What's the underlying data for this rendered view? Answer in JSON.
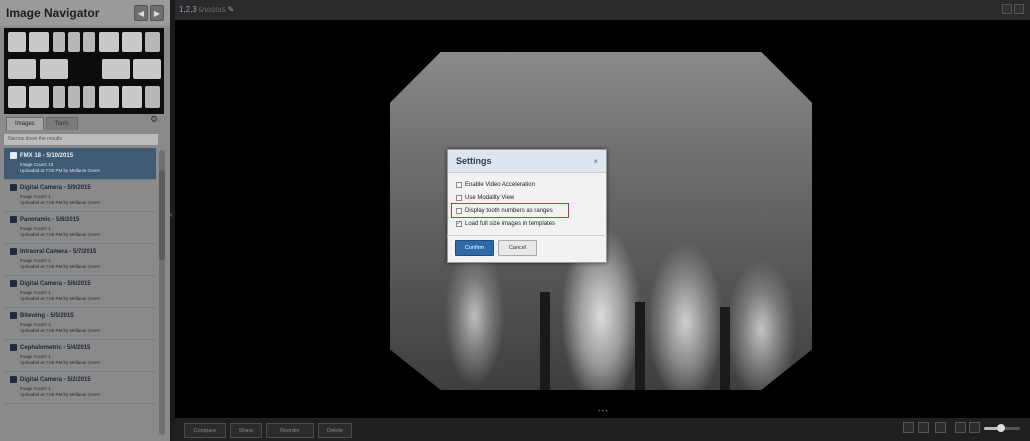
{
  "sidebar": {
    "title": "Image Navigator",
    "tabs": [
      {
        "label": "Images"
      },
      {
        "label": "Tools"
      }
    ],
    "filter_placeholder": "Narrow down the results",
    "items": [
      {
        "title": "FMX 18 - 5/10/2015",
        "count": "Image Count: 18",
        "uploaded": "Uploaded at 7:00 PM by Mellanie Green",
        "selected": true
      },
      {
        "title": "Digital Camera - 5/9/2015",
        "count": "Image Count: 1",
        "uploaded": "Uploaded at 7:00 PM by Mellanie Green"
      },
      {
        "title": "Panoramic - 5/8/2015",
        "count": "Image Count: 1",
        "uploaded": "Uploaded at 7:00 PM by Mellanie Green"
      },
      {
        "title": "Intraoral Camera - 5/7/2015",
        "count": "Image Count: 2",
        "uploaded": "Uploaded at 7:00 PM by Mellanie Green"
      },
      {
        "title": "Digital Camera - 5/6/2015",
        "count": "Image Count: 1",
        "uploaded": "Uploaded at 7:00 PM by Mellanie Green"
      },
      {
        "title": "Bitewing - 5/5/2015",
        "count": "Image Count: 4",
        "uploaded": "Uploaded at 7:00 PM by Mellanie Green"
      },
      {
        "title": "Cephalometric - 5/4/2015",
        "count": "Image Count: 1",
        "uploaded": "Uploaded at 7:00 PM by Mellanie Green"
      },
      {
        "title": "Digital Camera - 5/2/2015",
        "count": "Image Count: 1",
        "uploaded": "Uploaded at 7:00 PM by Mellanie Green"
      }
    ]
  },
  "viewer": {
    "title": "1,2,3",
    "date": "5/10/2015"
  },
  "dialog": {
    "title": "Settings",
    "close": "×",
    "options": [
      {
        "label": "Enable Video Acceleration",
        "checked": false
      },
      {
        "label": "Use Modality View",
        "checked": false
      },
      {
        "label": "Display tooth numbers as ranges",
        "checked": false
      },
      {
        "label": "Load full size images in templates",
        "checked": true
      }
    ],
    "confirm_label": "Confirm",
    "cancel_label": "Cancel"
  },
  "toolbar": {
    "compare": "Compare",
    "share": "Share",
    "reorder": "Reorder",
    "delete": "Delete"
  },
  "colors": {
    "accent": "#2c6aa8",
    "highlight": "#e03030",
    "selected_item": "#3f5b73"
  }
}
